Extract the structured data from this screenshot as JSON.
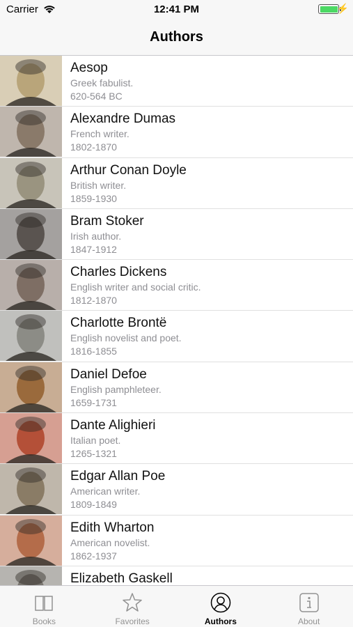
{
  "status": {
    "carrier": "Carrier",
    "time": "12:41 PM"
  },
  "nav": {
    "title": "Authors"
  },
  "authors": [
    {
      "name": "Aesop",
      "desc": "Greek fabulist.",
      "years": "620-564 BC",
      "tone": "#b9a57a"
    },
    {
      "name": "Alexandre Dumas",
      "desc": "French writer.",
      "years": "1802-1870",
      "tone": "#8a7a6a"
    },
    {
      "name": "Arthur Conan Doyle",
      "desc": "British writer.",
      "years": "1859-1930",
      "tone": "#9a9480"
    },
    {
      "name": "Bram Stoker",
      "desc": "Irish author.",
      "years": "1847-1912",
      "tone": "#5a5450"
    },
    {
      "name": "Charles Dickens",
      "desc": "English writer and social critic.",
      "years": "1812-1870",
      "tone": "#7e6e64"
    },
    {
      "name": "Charlotte Brontë",
      "desc": "English novelist and poet.",
      "years": "1816-1855",
      "tone": "#8c8c86"
    },
    {
      "name": "Daniel Defoe",
      "desc": "English pamphleteer.",
      "years": "1659-1731",
      "tone": "#9a6a3c"
    },
    {
      "name": "Dante Alighieri",
      "desc": "Italian poet.",
      "years": "1265-1321",
      "tone": "#b45038"
    },
    {
      "name": "Edgar Allan Poe",
      "desc": "American writer.",
      "years": "1809-1849",
      "tone": "#8a7c66"
    },
    {
      "name": "Edith Wharton",
      "desc": "American novelist.",
      "years": "1862-1937",
      "tone": "#b46c4a"
    },
    {
      "name": "Elizabeth Gaskell",
      "desc": "",
      "years": "",
      "tone": "#7a7670"
    }
  ],
  "tabs": [
    {
      "label": "Books",
      "icon": "book-icon"
    },
    {
      "label": "Favorites",
      "icon": "star-icon"
    },
    {
      "label": "Authors",
      "icon": "person-icon"
    },
    {
      "label": "About",
      "icon": "info-icon"
    }
  ],
  "colors": {
    "accent": "#000000",
    "inactive": "#929292",
    "secondary_text": "#8e8e93"
  }
}
